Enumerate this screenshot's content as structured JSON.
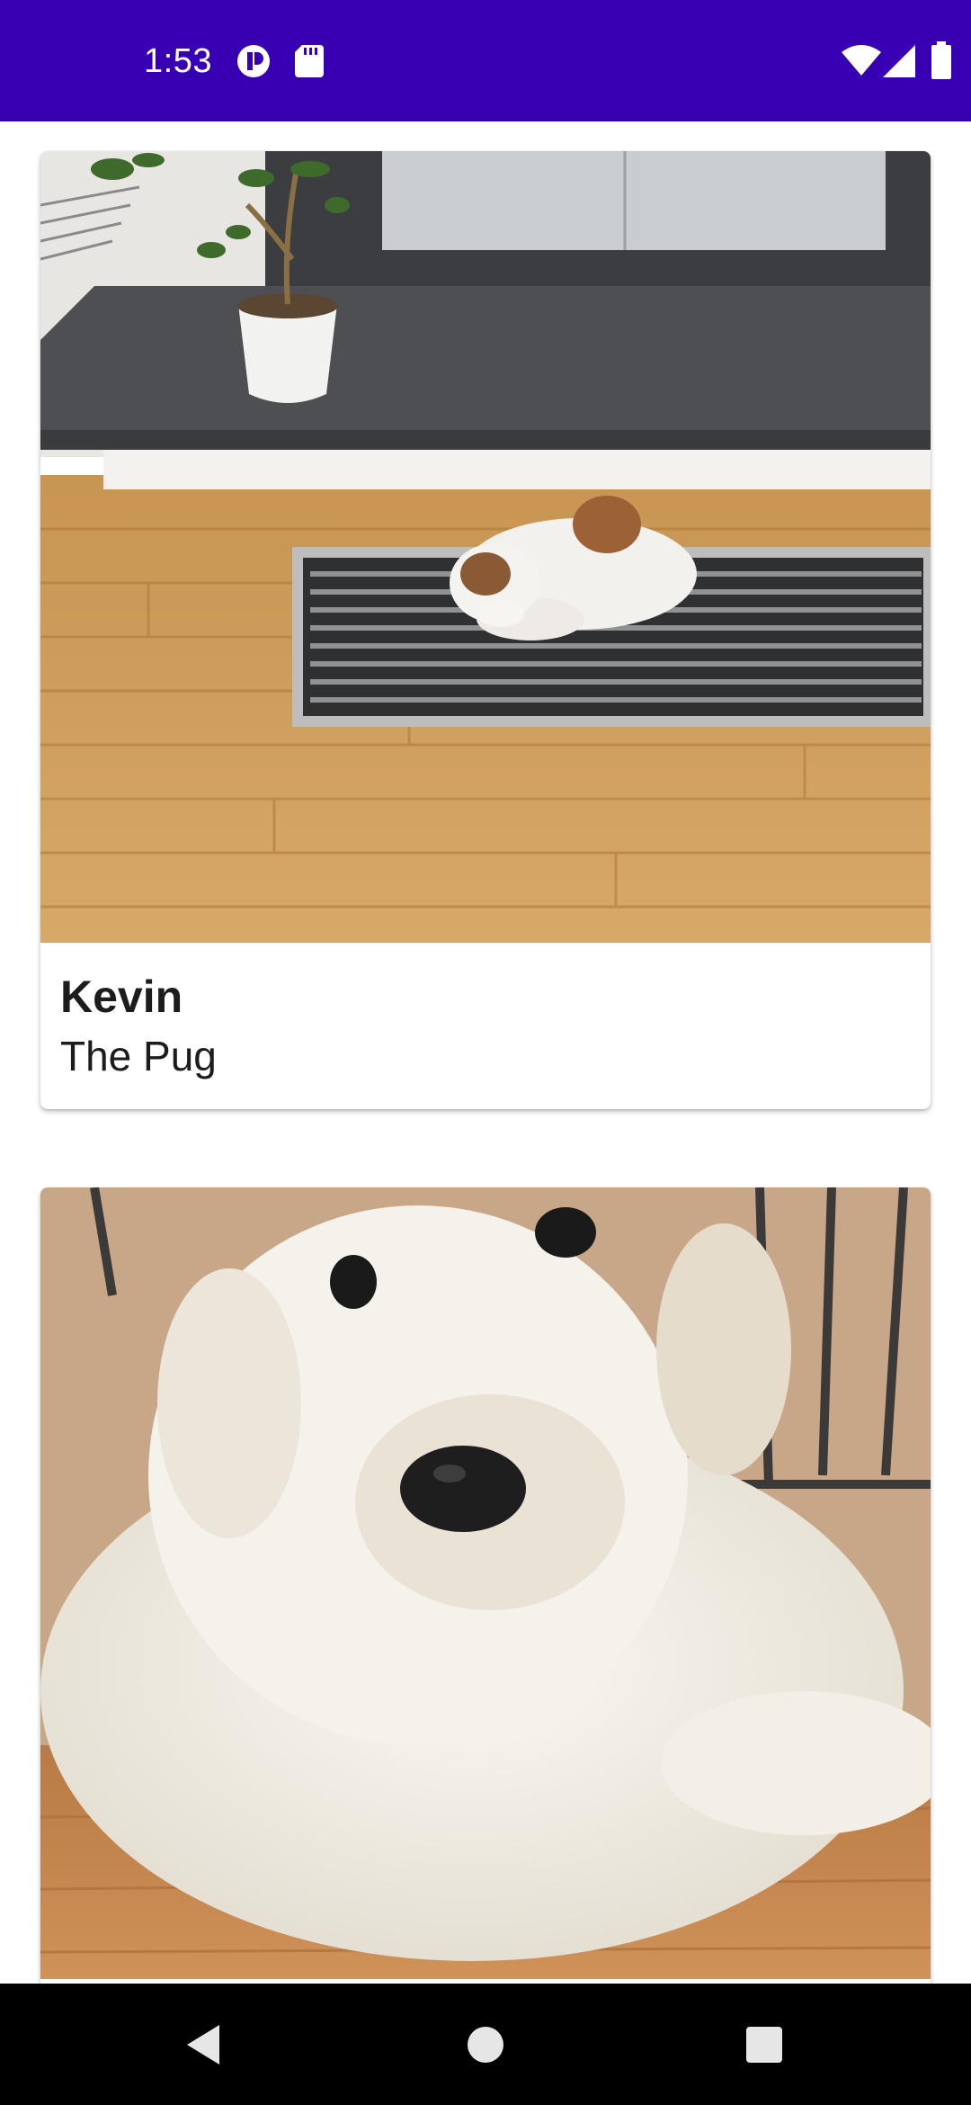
{
  "status_bar": {
    "time": "1:53",
    "background": "#3700b3",
    "left_icons": [
      "alert-circle-icon",
      "sd-card-icon"
    ],
    "right_icons": [
      "wifi-icon",
      "signal-icon",
      "battery-icon"
    ]
  },
  "cards": [
    {
      "name": "Kevin",
      "breed": "The Pug",
      "photo": "dog-sleeping-on-floor-vent-photo"
    },
    {
      "name": "",
      "breed": "",
      "photo": "white-fluffy-puppy-photo"
    }
  ],
  "nav_bar": {
    "buttons": [
      "back-icon",
      "home-icon",
      "recents-icon"
    ]
  }
}
